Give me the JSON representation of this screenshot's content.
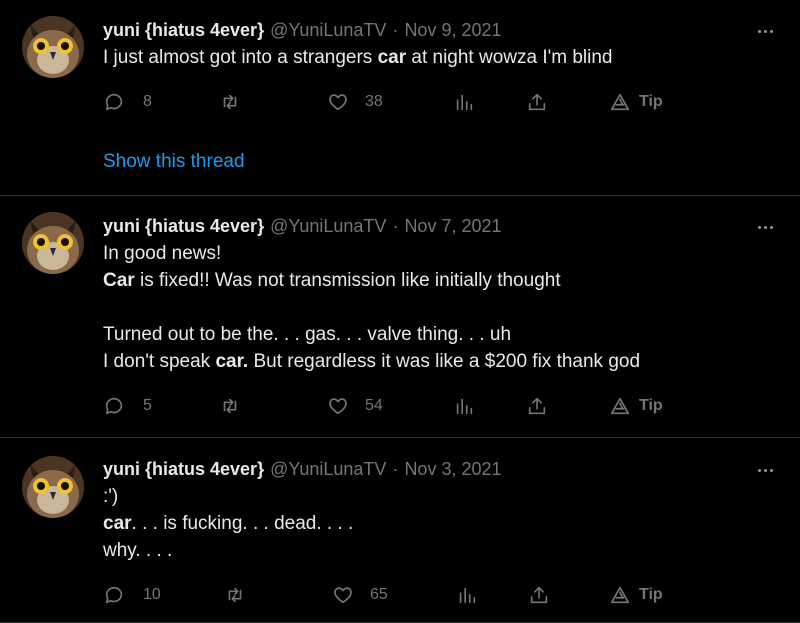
{
  "tweets": [
    {
      "name": "yuni {hiatus 4ever}",
      "handle": "@YuniLunaTV",
      "separator": "·",
      "date": "Nov 9, 2021",
      "lines": [
        {
          "a": "I just almost got into a strangers ",
          "b": "car",
          "c": " at night wowza I'm blind"
        }
      ],
      "replies": "8",
      "retweets": "",
      "likes": "38",
      "tip_label": "Tip",
      "show_thread": "Show this thread"
    },
    {
      "name": "yuni {hiatus 4ever}",
      "handle": "@YuniLunaTV",
      "separator": "·",
      "date": "Nov 7, 2021",
      "lines": [
        {
          "a": "In good news!",
          "b": "",
          "c": ""
        },
        {
          "a": "",
          "b": "Car",
          "c": " is fixed!! Was not transmission like initially thought"
        },
        {
          "a": "",
          "b": "",
          "c": ""
        },
        {
          "a": "Turned out to be the. . . gas. . . valve thing. . . uh",
          "b": "",
          "c": ""
        },
        {
          "a": "I don't speak ",
          "b": "car.",
          "c": " But regardless it was like a $200 fix thank god"
        }
      ],
      "replies": "5",
      "retweets": "",
      "likes": "54",
      "tip_label": "Tip"
    },
    {
      "name": "yuni {hiatus 4ever}",
      "handle": "@YuniLunaTV",
      "separator": "·",
      "date": "Nov 3, 2021",
      "lines": [
        {
          "a": ":')",
          "b": "",
          "c": ""
        },
        {
          "a": "",
          "b": "car",
          "c": ". . . is fucking. . . dead. . . ."
        },
        {
          "a": "why. . . .",
          "b": "",
          "c": ""
        }
      ],
      "replies": "10",
      "retweets": "",
      "likes": "65",
      "tip_label": "Tip"
    }
  ],
  "icons": {
    "reply": "reply-icon",
    "retweet": "retweet-icon",
    "like": "heart-icon",
    "analytics": "analytics-icon",
    "share": "share-icon",
    "tip": "tip-icon",
    "more": "more-icon"
  },
  "colors": {
    "background": "#000000",
    "text": "#e7e9ea",
    "muted": "#71767b",
    "link": "#1d9bf0",
    "divider": "#2f3336"
  }
}
